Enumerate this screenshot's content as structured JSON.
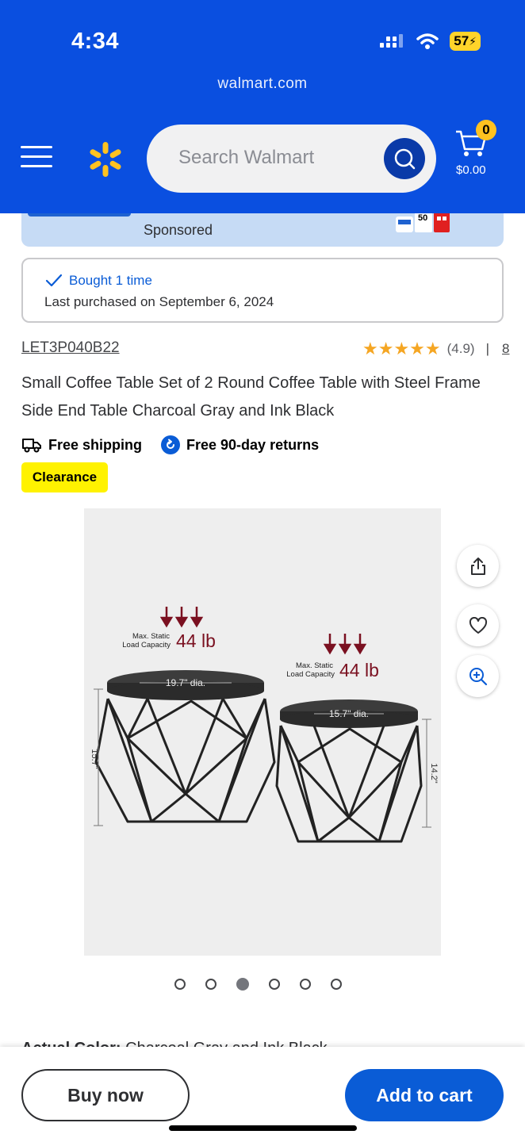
{
  "status_bar": {
    "time": "4:34",
    "battery": "57"
  },
  "browser": {
    "url": "walmart.com"
  },
  "header": {
    "search_placeholder": "Search Walmart",
    "cart_count": "0",
    "cart_total": "$0.00",
    "brand_color": "#0a4fe0",
    "spark_color": "#ffc220"
  },
  "banner": {
    "sponsored_label": "Sponsored",
    "pack_label": "50"
  },
  "purchase_history": {
    "bought_label": "Bought 1 time",
    "last_purchased": "Last purchased on September 6, 2024"
  },
  "product": {
    "sku": "LET3P040B22",
    "rating_value": "(4.9)",
    "rating_stars": 5,
    "rating_separator": "|",
    "review_count": "8",
    "title": "Small Coffee Table Set of 2 Round Coffee Table with Steel Frame Side End Table Charcoal Gray and Ink Black",
    "free_shipping": "Free shipping",
    "free_returns": "Free 90-day returns",
    "badge": "Clearance",
    "color_label": "Actual Color:",
    "color_value": "Charcoal Gray and Ink Black"
  },
  "image": {
    "left_table": {
      "capacity_label_1": "Max. Static",
      "capacity_label_2": "Load Capacity",
      "capacity_value": "44 lb",
      "diameter": "19.7\" dia.",
      "height": "15.7\""
    },
    "right_table": {
      "capacity_label_1": "Max. Static",
      "capacity_label_2": "Load Capacity",
      "capacity_value": "44 lb",
      "diameter": "15.7\" dia.",
      "height": "14.2\""
    }
  },
  "carousel": {
    "total": 6,
    "active_index": 2
  },
  "actions": {
    "buy_now": "Buy now",
    "add_to_cart": "Add to cart"
  },
  "icons": [
    "menu-icon",
    "walmart-spark-icon",
    "search-icon",
    "cart-icon",
    "check-icon",
    "truck-icon",
    "return-icon",
    "share-icon",
    "heart-icon",
    "zoom-icon",
    "signal-icon",
    "wifi-icon",
    "battery-icon"
  ]
}
